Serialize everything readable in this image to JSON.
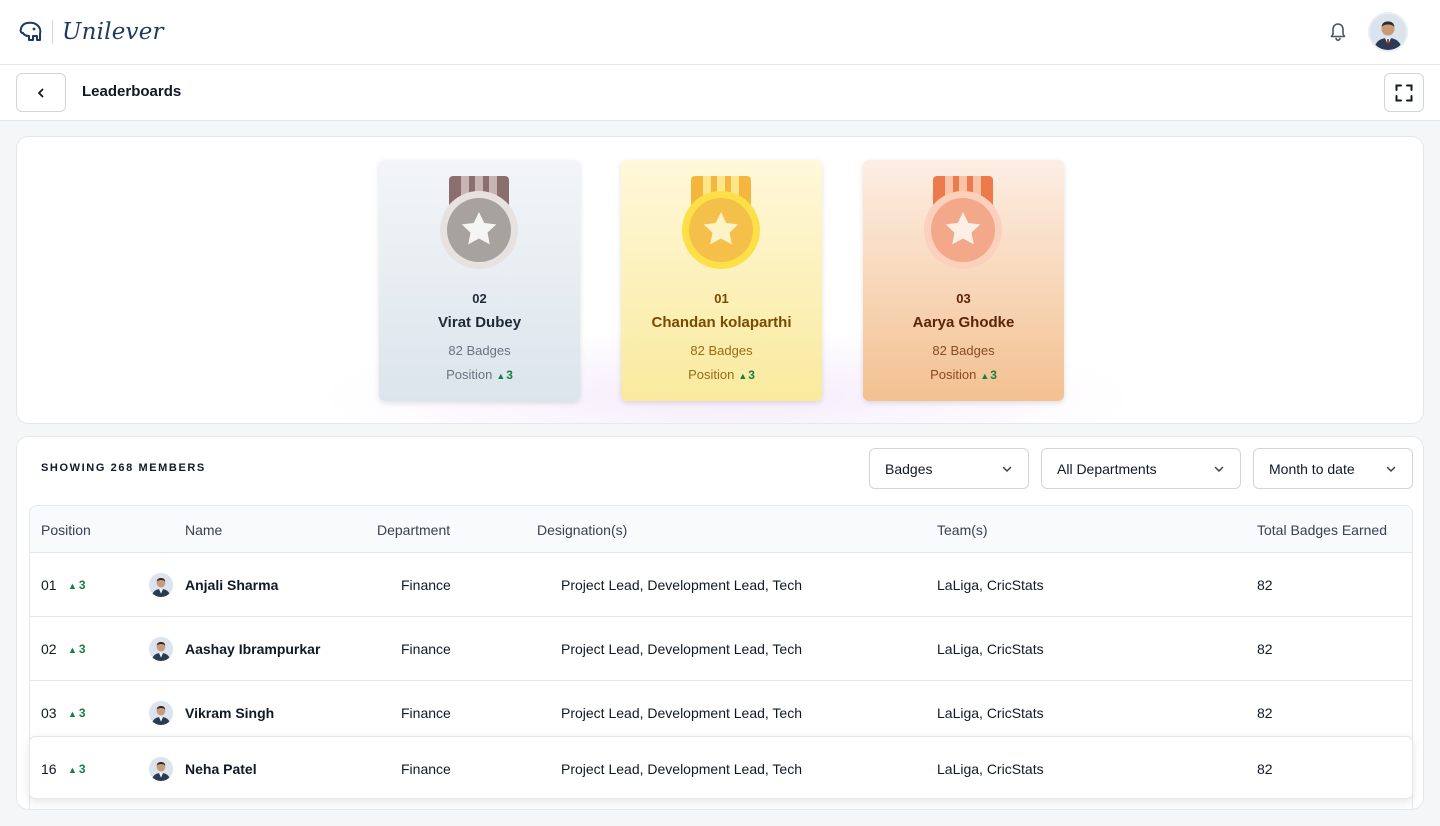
{
  "brand": {
    "name": "Unilever"
  },
  "header": {
    "title": "Leaderboards"
  },
  "podium": [
    {
      "rank": "02",
      "name": "Virat Dubey",
      "badges": "82 Badges",
      "position_label": "Position",
      "change": "3",
      "tier": "silver"
    },
    {
      "rank": "01",
      "name": "Chandan kolaparthi",
      "badges": "82 Badges",
      "position_label": "Position",
      "change": "3",
      "tier": "gold"
    },
    {
      "rank": "03",
      "name": "Aarya Ghodke",
      "badges": "82 Badges",
      "position_label": "Position",
      "change": "3",
      "tier": "bronze"
    }
  ],
  "members": {
    "showing": "SHOWING 268 MEMBERS",
    "filters": {
      "metric": "Badges",
      "department": "All Departments",
      "period": "Month to date"
    },
    "columns": [
      "Position",
      "Name",
      "Department",
      "Designation(s)",
      "Team(s)",
      "Total Badges Earned"
    ],
    "rows": [
      {
        "position": "01",
        "change": "3",
        "name": "Anjali Sharma",
        "department": "Finance",
        "designation": "Project Lead, Development Lead, Tech",
        "teams": "LaLiga, CricStats",
        "total": "82"
      },
      {
        "position": "02",
        "change": "3",
        "name": "Aashay Ibrampurkar",
        "department": "Finance",
        "designation": "Project Lead, Development Lead, Tech",
        "teams": "LaLiga, CricStats",
        "total": "82"
      },
      {
        "position": "03",
        "change": "3",
        "name": "Vikram Singh",
        "department": "Finance",
        "designation": "Project Lead, Development Lead, Tech",
        "teams": "LaLiga, CricStats",
        "total": "82"
      },
      {
        "position": "16",
        "change": "3",
        "name": "Neha Patel",
        "department": "Finance",
        "designation": "Project Lead, Development Lead, Tech",
        "teams": "LaLiga, CricStats",
        "total": "82"
      }
    ]
  },
  "colors": {
    "positive": "#15803d",
    "gold": "#f5c04a",
    "silver": "#a8a29e",
    "bronze": "#f3a88a"
  },
  "icons": {
    "brand": "elephant-logo-icon",
    "notifications": "bell-icon",
    "back": "chevron-left-icon",
    "fullscreen": "expand-icon",
    "dropdown": "chevron-down-icon",
    "trend": "arrow-up-icon"
  }
}
